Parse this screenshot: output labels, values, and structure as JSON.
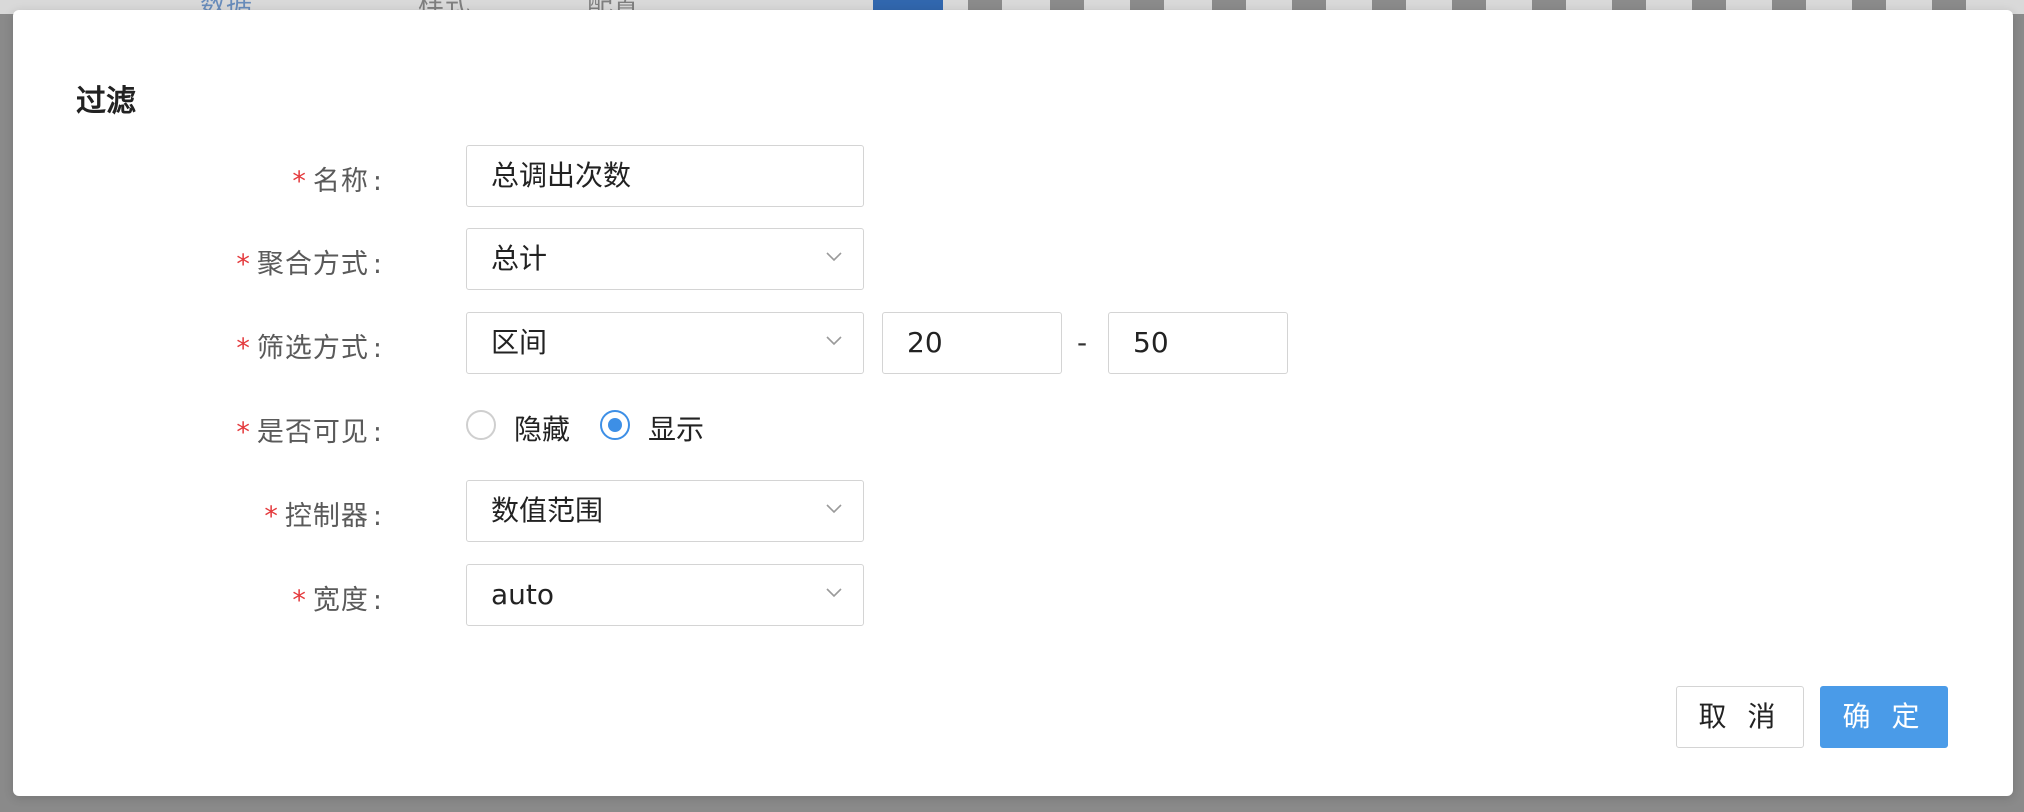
{
  "background": {
    "tabs": [
      "数据",
      "样式",
      "配置"
    ]
  },
  "modal": {
    "title": "过滤",
    "required_mark": "*",
    "colon": ":",
    "fields": {
      "name": {
        "label": "名称",
        "value": "总调出次数"
      },
      "aggregation": {
        "label": "聚合方式",
        "value": "总计"
      },
      "filter_mode": {
        "label": "筛选方式",
        "value": "区间",
        "min": "20",
        "separator": "-",
        "max": "50"
      },
      "visibility": {
        "label": "是否可见",
        "options": [
          "隐藏",
          "显示"
        ],
        "selected": "显示"
      },
      "controller": {
        "label": "控制器",
        "value": "数值范围"
      },
      "width": {
        "label": "宽度",
        "value": "auto"
      }
    },
    "buttons": {
      "cancel": "取 消",
      "ok": "确 定"
    }
  },
  "colors": {
    "accent": "#4a9be8",
    "required": "#e4393c",
    "border": "#d4d4d4"
  },
  "icons": {
    "dropdown": "chevron-down-icon"
  }
}
